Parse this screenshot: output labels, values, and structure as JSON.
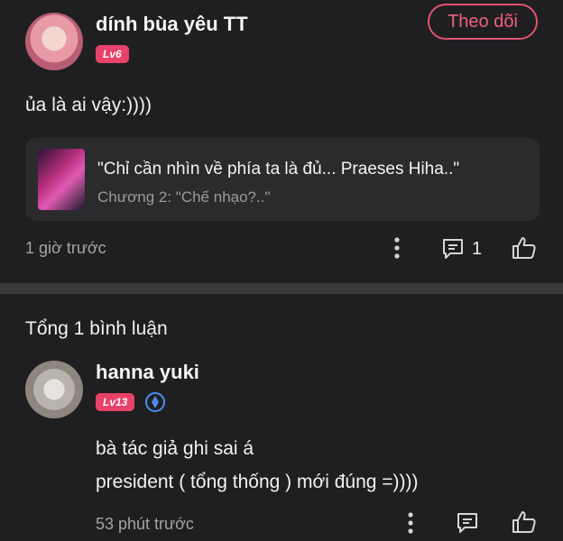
{
  "post": {
    "author_name": "dính bùa yêu TT",
    "author_level": "Lv6",
    "follow_label": "Theo dõi",
    "content": "ủa là ai vậy:))))",
    "attached_chapter": {
      "title": "\"Chỉ cần nhìn về phía ta là đủ... Praeses Hiha..\"",
      "subtitle": "Chương 2: \"Chế nhạo?..\""
    },
    "time": "1 giờ trước",
    "comment_count": "1"
  },
  "comments_section": {
    "title": "Tổng 1 bình luận",
    "comments": [
      {
        "author_name": "hanna yuki",
        "author_level": "Lv13",
        "content_lines": [
          "bà tác giả ghi sai á",
          "president ( tổng thống ) mới đúng =))))"
        ],
        "time": "53 phút trước"
      }
    ]
  },
  "colors": {
    "accent": "#e8416a",
    "verified_blue": "#4a8df0"
  }
}
